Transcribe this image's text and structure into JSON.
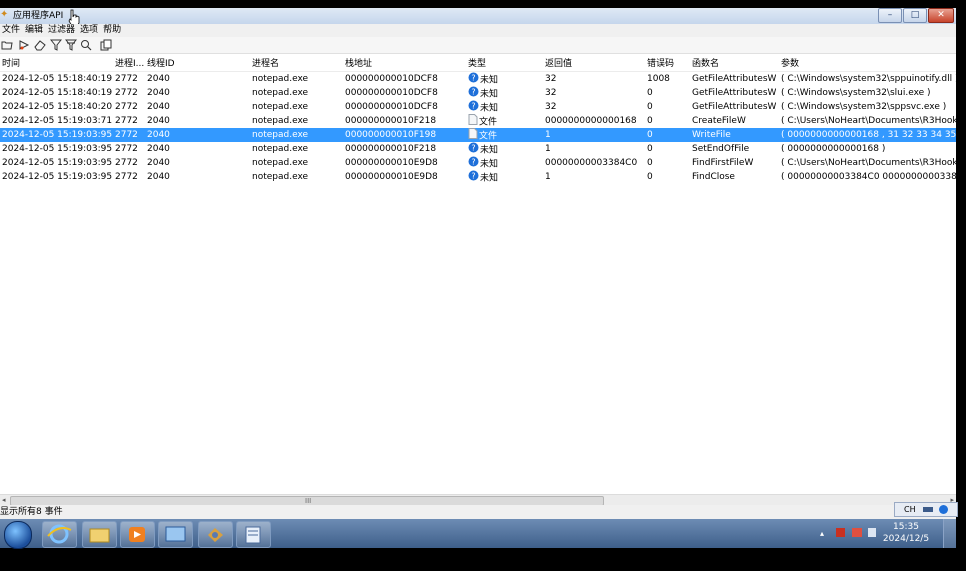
{
  "window": {
    "title": "应用程序API",
    "buttons": {
      "minimize": "–",
      "maximize": "□",
      "close": "✕"
    }
  },
  "menu": [
    "文件",
    "编辑",
    "过滤器",
    "选项",
    "帮助"
  ],
  "toolbar_icons": [
    "open-folder-icon",
    "run-icon",
    "eraser-icon",
    "filter-icon",
    "filter-edit-icon",
    "search-icon",
    "copy-icon"
  ],
  "columns": [
    "时间",
    "进程I...",
    "线程ID",
    "进程名",
    "栈地址",
    "类型",
    "返回值",
    "错误码",
    "函数名",
    "参数"
  ],
  "rows": [
    {
      "time": "2024-12-05 15:18:40:192",
      "pid": "2772",
      "tid": "2040",
      "proc": "notepad.exe",
      "stack": "000000000010DCF8",
      "type": "未知",
      "type_icon": "unknown",
      "ret": "32",
      "err": "1008",
      "func": "GetFileAttributesW",
      "params": "( C:\\Windows\\system32\\sppuinotify.dll )"
    },
    {
      "time": "2024-12-05 15:18:40:192",
      "pid": "2772",
      "tid": "2040",
      "proc": "notepad.exe",
      "stack": "000000000010DCF8",
      "type": "未知",
      "type_icon": "unknown",
      "ret": "32",
      "err": "0",
      "func": "GetFileAttributesW",
      "params": "( C:\\Windows\\system32\\slui.exe )"
    },
    {
      "time": "2024-12-05 15:18:40:207",
      "pid": "2772",
      "tid": "2040",
      "proc": "notepad.exe",
      "stack": "000000000010DCF8",
      "type": "未知",
      "type_icon": "unknown",
      "ret": "32",
      "err": "0",
      "func": "GetFileAttributesW",
      "params": "( C:\\Windows\\system32\\sppsvc.exe )"
    },
    {
      "time": "2024-12-05 15:19:03:717",
      "pid": "2772",
      "tid": "2040",
      "proc": "notepad.exe",
      "stack": "000000000010F218",
      "type": "文件",
      "type_icon": "file",
      "ret": "0000000000000168",
      "err": "0",
      "func": "CreateFileW",
      "params": "( C:\\Users\\NoHeart\\Documents\\R3HookTe"
    },
    {
      "time": "2024-12-05 15:19:03:951",
      "pid": "2772",
      "tid": "2040",
      "proc": "notepad.exe",
      "stack": "000000000010F198",
      "type": "文件",
      "type_icon": "file",
      "ret": "1",
      "err": "0",
      "func": "WriteFile",
      "params": "( 0000000000000168 , 31 32 33 34 35 36"
    },
    {
      "time": "2024-12-05 15:19:03:951",
      "pid": "2772",
      "tid": "2040",
      "proc": "notepad.exe",
      "stack": "000000000010F218",
      "type": "未知",
      "type_icon": "unknown",
      "ret": "1",
      "err": "0",
      "func": "SetEndOfFile",
      "params": "( 0000000000000168 )"
    },
    {
      "time": "2024-12-05 15:19:03:951",
      "pid": "2772",
      "tid": "2040",
      "proc": "notepad.exe",
      "stack": "000000000010E9D8",
      "type": "未知",
      "type_icon": "unknown",
      "ret": "00000000003384C0",
      "err": "0",
      "func": "FindFirstFileW",
      "params": "( C:\\Users\\NoHeart\\Documents\\R3HookTe"
    },
    {
      "time": "2024-12-05 15:19:03:951",
      "pid": "2772",
      "tid": "2040",
      "proc": "notepad.exe",
      "stack": "000000000010E9D8",
      "type": "未知",
      "type_icon": "unknown",
      "ret": "1",
      "err": "0",
      "func": "FindClose",
      "params": "( 00000000003384C0 00000000003384C"
    }
  ],
  "selected_row": 4,
  "scrollbar": {
    "left": "◂",
    "right": "▸",
    "grip": "III"
  },
  "status": "显示所有8 事件",
  "langbar": {
    "lang": "CH"
  },
  "clock": {
    "time": "15:35",
    "date": "2024/12/5"
  },
  "colors": {
    "selection": "#3399ff",
    "unknown_icon": "#1e6fd9",
    "file_icon": "#9aa3ad"
  }
}
